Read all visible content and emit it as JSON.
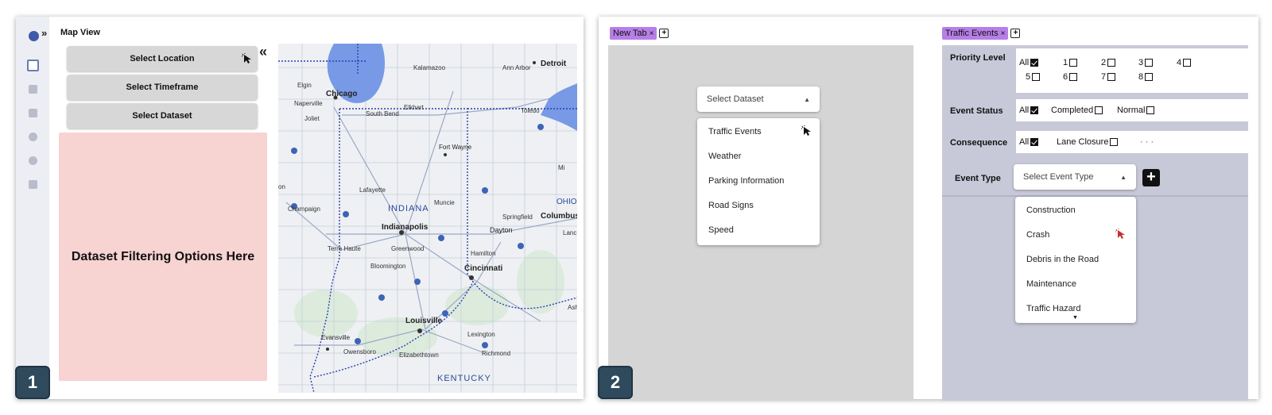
{
  "panel1": {
    "badge": "1",
    "title": "Map View",
    "expand_icon": "double-chevron-right-icon",
    "collapse_icon": "double-chevron-left-icon",
    "buttons": {
      "location": "Select Location",
      "timeframe": "Select Timeframe",
      "dataset": "Select Dataset"
    },
    "filter_placeholder": "Dataset Filtering Options Here",
    "map_labels": {
      "chicago": "Chicago",
      "detroit": "Detroit",
      "ann_arbor": "Ann Arbor",
      "kalamazoo": "Kalamazoo",
      "elgin": "Elgin",
      "naperville": "Naperville",
      "joliet": "Joliet",
      "south_bend": "South Bend",
      "elkhart": "Elkhart",
      "toledo": "Toledo",
      "fort_wayne": "Fort Wayne",
      "lafayette": "Lafayette",
      "indiana": "INDIANA",
      "champaign": "Champaign",
      "muncie": "Muncie",
      "ohio": "OHIO",
      "springfield": "Springfield",
      "columbus": "Columbus",
      "indianapolis": "Indianapolis",
      "dayton": "Dayton",
      "terre_haute": "Terre Haute",
      "greenwood": "Greenwood",
      "hamilton": "Hamilton",
      "bloomington": "Bloomington",
      "cincinnati": "Cincinnati",
      "louisville": "Louisville",
      "evansville": "Evansville",
      "lexington": "Lexington",
      "owensboro": "Owensboro",
      "elizabethtown": "Elizabethtown",
      "richmond": "Richmond",
      "kentucky": "KENTUCKY",
      "lanc": "Lanc",
      "mi": "Mi",
      "ashl": "Ashl",
      "on": "on"
    }
  },
  "panel2": {
    "badge": "2",
    "left_tab": "New Tab",
    "right_tab": "Traffic Events",
    "close_glyph": "×",
    "add_tab_glyph": "+",
    "dataset_select": {
      "placeholder": "Select Dataset",
      "options": [
        "Traffic Events",
        "Weather",
        "Parking Information",
        "Road Signs",
        "Speed"
      ]
    },
    "priority": {
      "label": "Priority Level",
      "all": "All",
      "levels": [
        "1",
        "2",
        "3",
        "4",
        "5",
        "6",
        "7",
        "8"
      ]
    },
    "status": {
      "label": "Event Status",
      "all": "All",
      "options": [
        "Completed",
        "Normal"
      ]
    },
    "consequence": {
      "label": "Consequence",
      "all": "All",
      "options": [
        "Lane Closure"
      ],
      "more": "· · ·"
    },
    "event_type": {
      "label": "Event Type",
      "placeholder": "Select Event Type",
      "add_glyph": "+",
      "options": [
        "Construction",
        "Crash",
        "Debris in the Road",
        "Maintenance",
        "Traffic Hazard"
      ]
    }
  },
  "colors": {
    "tab_accent": "#b67ee6",
    "filter_area": "#f7d3d2",
    "right_area": "#c8c9d8",
    "badge": "#2f4a5c"
  }
}
